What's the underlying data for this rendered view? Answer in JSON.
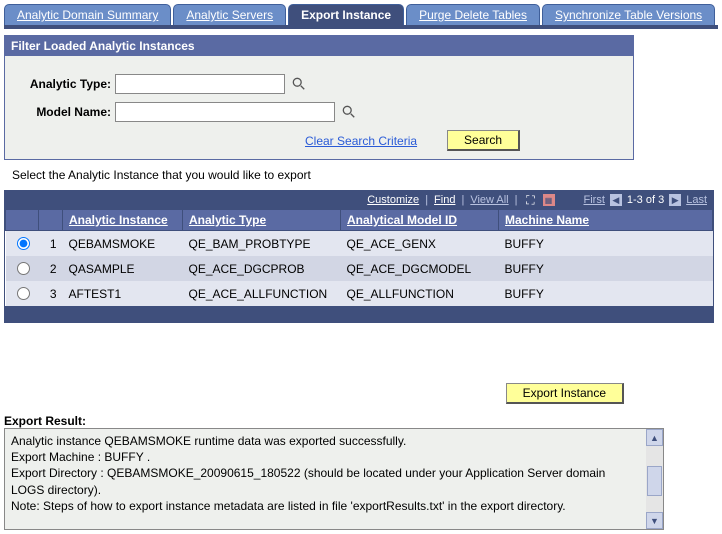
{
  "tabs": [
    {
      "label": "Analytic Domain Summary"
    },
    {
      "label": "Analytic Servers"
    },
    {
      "label": "Export Instance"
    },
    {
      "label": "Purge Delete Tables"
    },
    {
      "label": "Synchronize Table Versions"
    }
  ],
  "active_tab_index": 2,
  "filter": {
    "title": "Filter Loaded Analytic Instances",
    "analytic_type_label": "Analytic Type:",
    "analytic_type_value": "",
    "model_name_label": "Model Name:",
    "model_name_value": "",
    "clear_link": "Clear Search Criteria",
    "search_label": "Search"
  },
  "instruction": "Select the Analytic Instance that you would like to export",
  "grid": {
    "nav": {
      "customize": "Customize",
      "find": "Find",
      "view_all": "View All",
      "first": "First",
      "range": "1-3 of 3",
      "last": "Last"
    },
    "headers": {
      "analytic_instance": "Analytic Instance",
      "analytic_type": "Analytic Type",
      "analytical_model_id": "Analytical Model ID",
      "machine_name": "Machine Name"
    },
    "rows": [
      {
        "idx": "1",
        "selected": true,
        "analytic_instance": "QEBAMSMOKE",
        "analytic_type": "QE_BAM_PROBTYPE",
        "analytical_model_id": "QE_ACE_GENX",
        "machine_name": "BUFFY"
      },
      {
        "idx": "2",
        "selected": false,
        "analytic_instance": "QASAMPLE",
        "analytic_type": "QE_ACE_DGCPROB",
        "analytical_model_id": "QE_ACE_DGCMODEL",
        "machine_name": "BUFFY"
      },
      {
        "idx": "3",
        "selected": false,
        "analytic_instance": "AFTEST1",
        "analytic_type": "QE_ACE_ALLFUNCTION",
        "analytical_model_id": "QE_ALLFUNCTION",
        "machine_name": "BUFFY"
      }
    ]
  },
  "export_button_label": "Export Instance",
  "result": {
    "label": "Export Result:",
    "text": "Analytic instance QEBAMSMOKE runtime data was exported successfully.\nExport Machine : BUFFY .\nExport Directory : QEBAMSMOKE_20090615_180522 (should be located under your Application Server domain LOGS directory).\nNote: Steps of how to export instance metadata are listed in file 'exportResults.txt' in the export directory."
  }
}
